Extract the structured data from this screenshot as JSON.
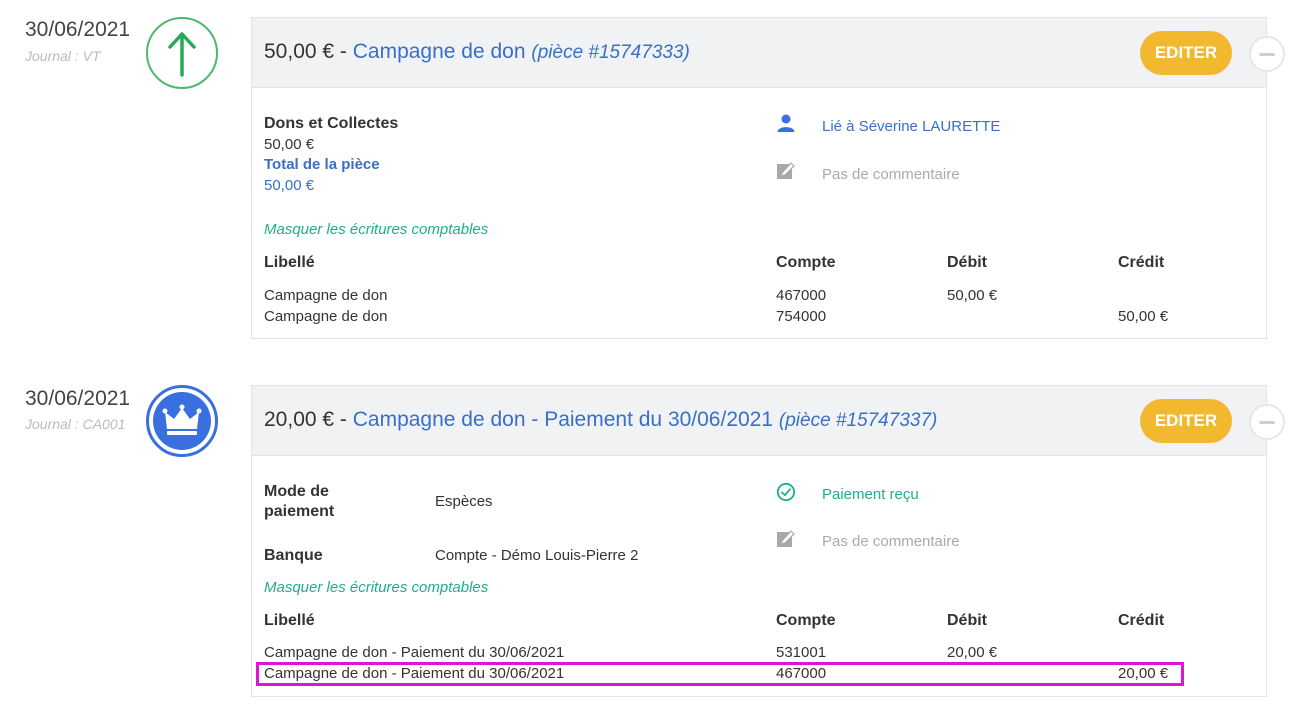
{
  "entries": [
    {
      "date": "30/06/2021",
      "journal": "Journal : VT",
      "icon": "arrow-up-icon",
      "amount": "50,00 € - ",
      "title": "Campagne de don",
      "piece": "(pièce #15747333)",
      "edit_label": "EDITER",
      "left_block": {
        "label1": "Dons et Collectes",
        "value1": "50,00 €",
        "label2": "Total de la pièce",
        "value2": "50,00 €"
      },
      "linked": "Lié à Séverine LAURETTE",
      "comment": "Pas de commentaire",
      "toggle": "Masquer les écritures comptables",
      "headers": [
        "Libellé",
        "Compte",
        "Débit",
        "Crédit"
      ],
      "rows": [
        {
          "libelle": "Campagne de don",
          "compte": "467000",
          "debit": "50,00 €",
          "credit": ""
        },
        {
          "libelle": "Campagne de don",
          "compte": "754000",
          "debit": "",
          "credit": "50,00 €"
        }
      ]
    },
    {
      "date": "30/06/2021",
      "journal": "Journal : CA001",
      "icon": "crown-icon",
      "amount": "20,00 € - ",
      "title": "Campagne de don - Paiement du 30/06/2021",
      "piece": "(pièce #15747337)",
      "edit_label": "EDITER",
      "left_block": {
        "mode_label_1": "Mode de",
        "mode_label_2": "paiement",
        "mode_value": "Espèces",
        "bank_label": "Banque",
        "bank_value": "Compte - Démo Louis-Pierre 2"
      },
      "status": "Paiement reçu",
      "comment": "Pas de commentaire",
      "toggle": "Masquer les écritures comptables",
      "headers": [
        "Libellé",
        "Compte",
        "Débit",
        "Crédit"
      ],
      "rows": [
        {
          "libelle": "Campagne de don - Paiement du 30/06/2021",
          "compte": "531001",
          "debit": "20,00 €",
          "credit": ""
        },
        {
          "libelle": "Campagne de don - Paiement du 30/06/2021",
          "compte": "467000",
          "debit": "",
          "credit": "20,00 €"
        }
      ]
    }
  ],
  "colors": {
    "accent_blue": "#3a6fc7",
    "accent_green": "#1fae8c",
    "edit_yellow": "#f1b830",
    "highlight_magenta": "#e014d6"
  }
}
